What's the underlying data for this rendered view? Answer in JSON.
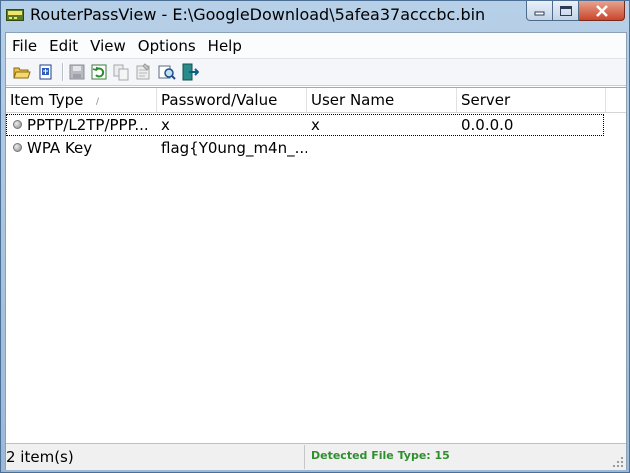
{
  "window": {
    "title": "RouterPassView  -  E:\\GoogleDownload\\5afea37acccbc.bin"
  },
  "menu": [
    "File",
    "Edit",
    "View",
    "Options",
    "Help"
  ],
  "toolbar": {
    "icons": [
      "open-folder-icon",
      "open-file-icon",
      "save-icon",
      "refresh-icon",
      "copy-icon",
      "properties-icon",
      "find-icon",
      "exit-icon"
    ]
  },
  "list": {
    "columns": [
      "Item Type",
      "Password/Value",
      "User Name",
      "Server"
    ],
    "rows": [
      {
        "item_type": "PPTP/L2TP/PPP...",
        "value": "x",
        "user": "x",
        "server": "0.0.0.0"
      },
      {
        "item_type": "WPA Key",
        "value": "flag{Y0ung_m4n_...",
        "user": "",
        "server": ""
      }
    ]
  },
  "status": {
    "count": "2 item(s)",
    "file_type": "Detected File Type: 15"
  },
  "colors": {
    "status_text": "#2f8f2f",
    "title_bar": "#b7d0e8",
    "close_button": "#c8462c"
  }
}
